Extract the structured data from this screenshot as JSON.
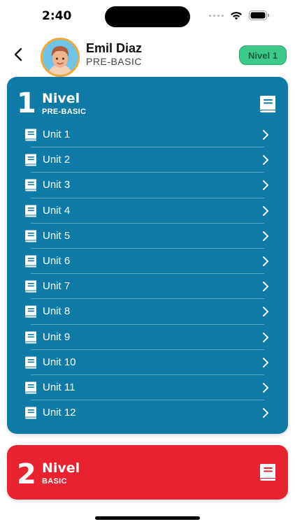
{
  "status_bar": {
    "time": "2:40"
  },
  "header": {
    "user_name": "Emil Diaz",
    "user_level": "PRE-BASIC",
    "level_badge": "Nivel 1"
  },
  "levels": [
    {
      "number": "1",
      "title": "Nivel",
      "subtitle": "PRE-BASIC",
      "color": "#0f7aa5",
      "units": [
        "Unit 1",
        "Unit 2",
        "Unit 3",
        "Unit 4",
        "Unit 5",
        "Unit 6",
        "Unit 7",
        "Unit 8",
        "Unit 9",
        "Unit 10",
        "Unit 11",
        "Unit 12"
      ]
    },
    {
      "number": "2",
      "title": "Nivel",
      "subtitle": "BASIC",
      "color": "#e8232f"
    }
  ],
  "icons": {
    "back": "chevron-left-icon",
    "book": "book-icon",
    "row_chevron": "chevron-right-icon",
    "wifi": "wifi-icon",
    "battery": "battery-icon",
    "signal": "cellular-signal-icon"
  },
  "colors": {
    "badge_bg": "#3cc98a",
    "badge_text": "#1a5f3f",
    "avatar_ring": "#f1a83b"
  }
}
